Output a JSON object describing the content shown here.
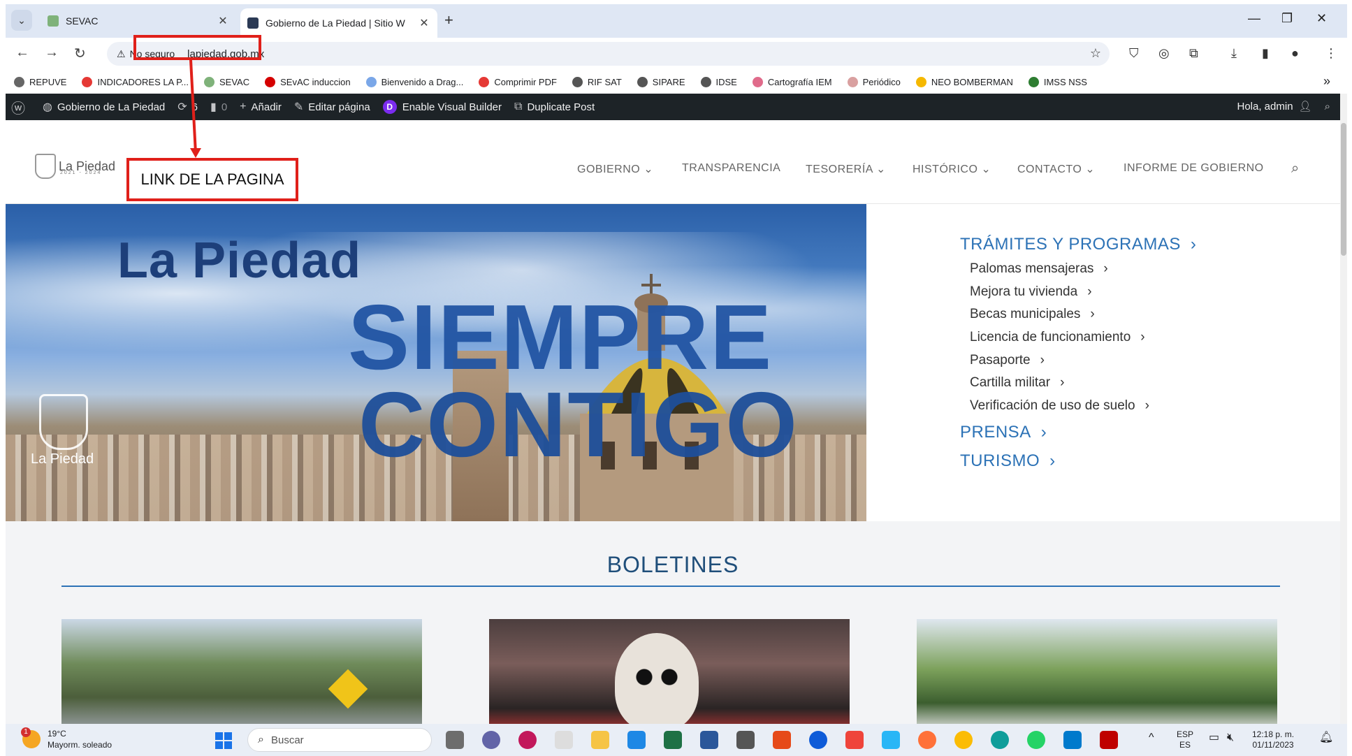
{
  "browser": {
    "tabs": [
      {
        "title": "SEVAC",
        "active": false
      },
      {
        "title": "Gobierno de La Piedad | Sitio W",
        "active": true
      }
    ],
    "security_label": "No seguro",
    "url": "lapiedad.gob.mx",
    "bookmarks": [
      "REPUVE",
      "INDICADORES LA P...",
      "SEVAC",
      "SEvAC induccion",
      "Bienvenido a Drag...",
      "Comprimir PDF",
      "RIF SAT",
      "SIPARE",
      "IDSE",
      "Cartografía IEM",
      "Periódico",
      "NEO BOMBERMAN",
      "IMSS NSS"
    ]
  },
  "adminbar": {
    "site_name": "Gobierno de La Piedad",
    "updates": "6",
    "comments": "0",
    "add": "Añadir",
    "edit": "Editar página",
    "visual_builder": "Enable Visual Builder",
    "duplicate": "Duplicate Post",
    "greeting": "Hola, admin"
  },
  "site": {
    "logo_name": "La Piedad",
    "logo_years": "2021 - 2024",
    "nav": [
      "GOBIERNO",
      "TRANSPARENCIA",
      "TESORERÍA",
      "HISTÓRICO",
      "CONTACTO",
      "INFORME DE GOBIERNO"
    ],
    "hero": {
      "line1": "La Piedad",
      "line2": "SIEMPRE",
      "line3": "CONTIGO",
      "seal_name": "La Piedad"
    },
    "sidemenu": {
      "tramites": "TRÁMITES Y PROGRAMAS",
      "items": [
        "Palomas mensajeras",
        "Mejora tu vivienda",
        "Becas municipales",
        "Licencia de funcionamiento",
        "Pasaporte",
        "Cartilla militar",
        "Verificación de uso de suelo"
      ],
      "prensa": "PRENSA",
      "turismo": "TURISMO"
    },
    "boletines_title": "BOLETINES"
  },
  "annotation": {
    "label": "LINK DE LA PAGINA"
  },
  "taskbar": {
    "temp": "19°C",
    "weather": "Mayorm. soleado",
    "weather_badge": "1",
    "search_placeholder": "Buscar",
    "lang_top": "ESP",
    "lang_bottom": "ES",
    "time": "12:18 p. m.",
    "date": "01/11/2023"
  }
}
